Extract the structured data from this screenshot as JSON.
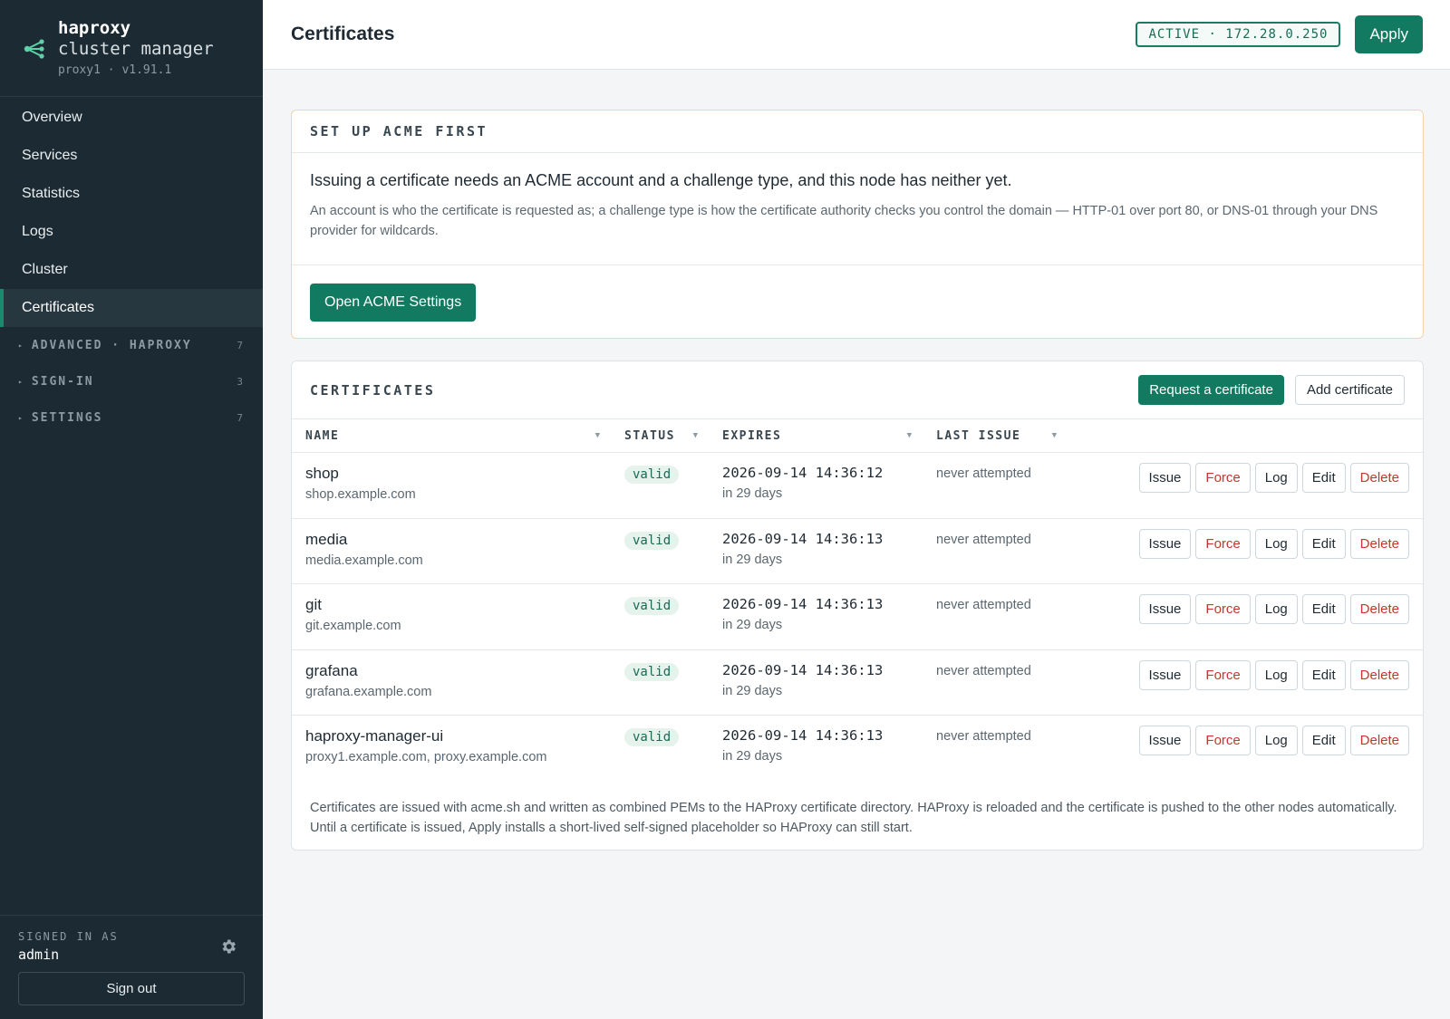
{
  "brand": {
    "title": "haproxy",
    "subtitle": "cluster manager",
    "version": "proxy1 · v1.91.1",
    "icon": "graph-branch-icon",
    "accent": "#1a8a6e"
  },
  "nav": {
    "items": [
      {
        "label": "Overview"
      },
      {
        "label": "Services"
      },
      {
        "label": "Statistics"
      },
      {
        "label": "Logs"
      },
      {
        "label": "Cluster"
      },
      {
        "label": "Certificates",
        "active": true
      }
    ],
    "groups": [
      {
        "label": "ADVANCED · HAPROXY",
        "count": "7"
      },
      {
        "label": "SIGN-IN",
        "count": "3"
      },
      {
        "label": "SETTINGS",
        "count": "7"
      }
    ]
  },
  "footer": {
    "signed_label": "SIGNED IN AS",
    "user": "admin",
    "signout": "Sign out",
    "settings_icon": "gear-icon"
  },
  "topbar": {
    "title": "Certificates",
    "status": "ACTIVE · 172.28.0.250",
    "apply": "Apply"
  },
  "acme": {
    "heading": "SET UP ACME FIRST",
    "lead": "Issuing a certificate needs an ACME account and a challenge type, and this node has neither yet.",
    "desc": "An account is who the certificate is requested as; a challenge type is how the certificate authority checks you control the domain — HTTP-01 over port 80, or DNS-01 through your DNS provider for wildcards.",
    "button": "Open ACME Settings"
  },
  "certs": {
    "heading": "CERTIFICATES",
    "request_btn": "Request a certificate",
    "add_btn": "Add certificate",
    "columns": [
      "NAME",
      "STATUS",
      "EXPIRES",
      "LAST ISSUE"
    ],
    "actions": [
      "Issue",
      "Force",
      "Log",
      "Edit",
      "Delete"
    ],
    "rows": [
      {
        "name": "shop",
        "domains": "shop.example.com",
        "status": "valid",
        "expires": "2026-09-14 14:36:12",
        "relative": "in 29 days",
        "last": "never attempted"
      },
      {
        "name": "media",
        "domains": "media.example.com",
        "status": "valid",
        "expires": "2026-09-14 14:36:13",
        "relative": "in 29 days",
        "last": "never attempted"
      },
      {
        "name": "git",
        "domains": "git.example.com",
        "status": "valid",
        "expires": "2026-09-14 14:36:13",
        "relative": "in 29 days",
        "last": "never attempted"
      },
      {
        "name": "grafana",
        "domains": "grafana.example.com",
        "status": "valid",
        "expires": "2026-09-14 14:36:13",
        "relative": "in 29 days",
        "last": "never attempted"
      },
      {
        "name": "haproxy-manager-ui",
        "domains": "proxy1.example.com, proxy.example.com",
        "status": "valid",
        "expires": "2026-09-14 14:36:13",
        "relative": "in 29 days",
        "last": "never attempted"
      }
    ],
    "note": "Certificates are issued with acme.sh and written as combined PEMs to the HAProxy certificate directory. HAProxy is reloaded and the certificate is pushed to the other nodes automatically. Until a certificate is issued, Apply installs a short-lived self-signed placeholder so HAProxy can still start."
  }
}
